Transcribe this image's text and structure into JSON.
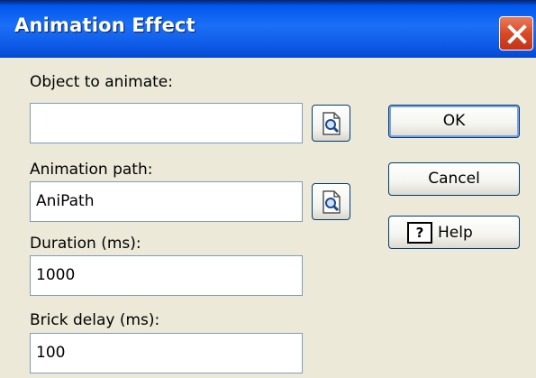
{
  "window": {
    "title": "Animation Effect"
  },
  "form": {
    "object_label": "Object to animate:",
    "object_value": "",
    "path_label": "Animation path:",
    "path_value": "AniPath",
    "duration_label": "Duration (ms):",
    "duration_value": "1000",
    "brick_delay_label": "Brick delay (ms):",
    "brick_delay_value": "100"
  },
  "buttons": {
    "ok": "OK",
    "cancel": "Cancel",
    "help": "Help",
    "help_icon_glyph": "?"
  },
  "icons": {
    "close": "close-icon",
    "browse": "browse-magnifier-icon",
    "help": "help-icon"
  },
  "colors": {
    "titlebar": "#0058ee",
    "close_button": "#d84a25",
    "dialog_background": "#ece9d8",
    "field_border": "#7f9db9"
  }
}
